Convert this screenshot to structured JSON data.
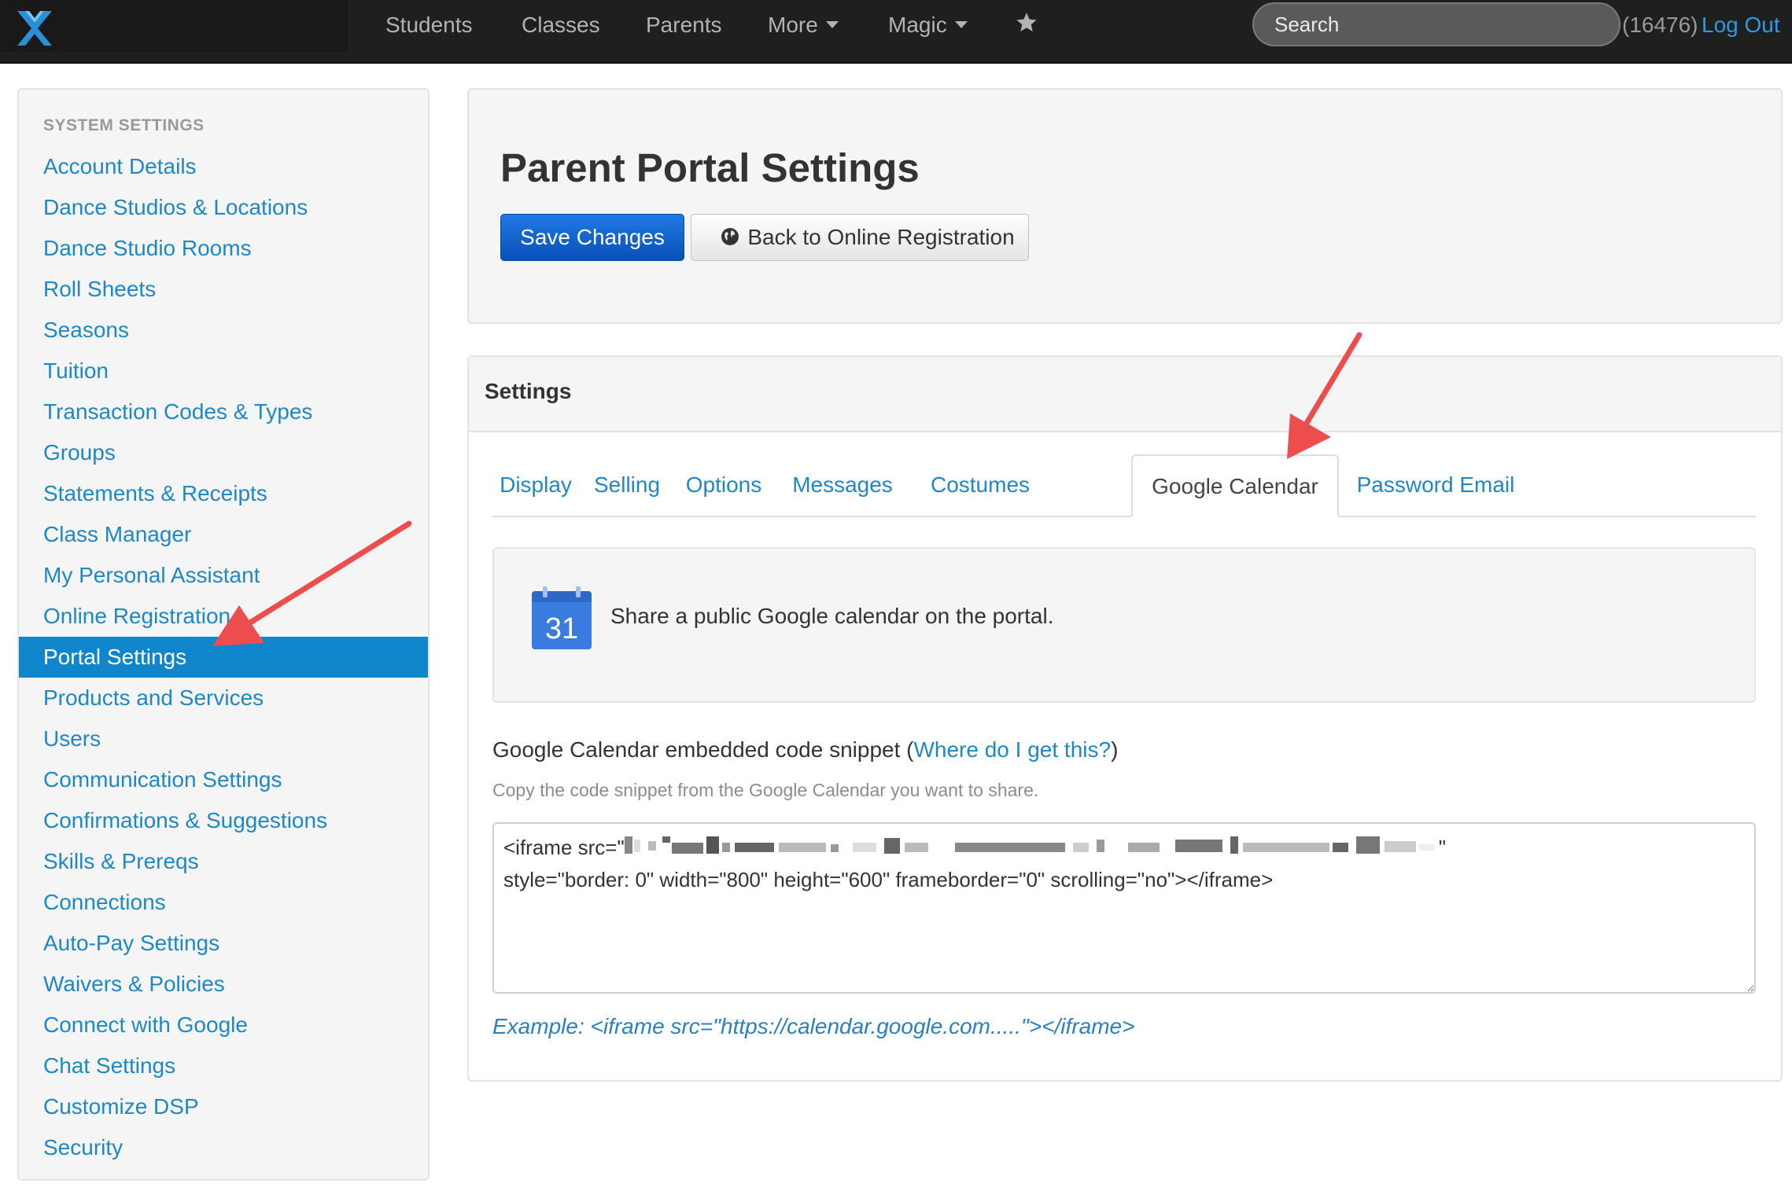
{
  "navbar": {
    "items": [
      "Students",
      "Classes",
      "Parents",
      "More",
      "Magic"
    ],
    "search_placeholder": "Search",
    "user_count": "(16476)",
    "logout": "Log Out"
  },
  "sidebar": {
    "header": "SYSTEM SETTINGS",
    "items": [
      "Account Details",
      "Dance Studios & Locations",
      "Dance Studio Rooms",
      "Roll Sheets",
      "Seasons",
      "Tuition",
      "Transaction Codes & Types",
      "Groups",
      "Statements & Receipts",
      "Class Manager",
      "My Personal Assistant",
      "Online Registration",
      "Portal Settings",
      "Products and Services",
      "Users",
      "Communication Settings",
      "Confirmations & Suggestions",
      "Skills & Prereqs",
      "Connections",
      "Auto-Pay Settings",
      "Waivers & Policies",
      "Connect with Google",
      "Chat Settings",
      "Customize DSP",
      "Security"
    ],
    "active": "Portal Settings"
  },
  "header": {
    "title": "Parent Portal Settings",
    "save_label": "Save Changes",
    "back_label": "Back to Online Registration"
  },
  "settings": {
    "title": "Settings",
    "tabs": [
      "Display",
      "Selling",
      "Options",
      "Messages",
      "Costumes",
      "Google Calendar",
      "Password Email"
    ],
    "active_tab": "Google Calendar",
    "info": {
      "calendar_day": "31",
      "text": "Share a public Google calendar on the portal."
    },
    "snippet_label_prefix": "Google Calendar embedded code snippet (",
    "snippet_link": "Where do I get this?",
    "snippet_label_suffix": ")",
    "help": "Copy the code snippet from the Google Calendar you want to share.",
    "code_line1_start": "<iframe src=\"",
    "code_line1_end": "\"",
    "code_line2": "style=\"border: 0\" width=\"800\" height=\"600\" frameborder=\"0\" scrolling=\"no\"></iframe>",
    "example": "Example: <iframe src=\"https://calendar.google.com.....\"></iframe>"
  },
  "colors": {
    "navbar_bg": "#1f1f1f",
    "link": "#1e88c7",
    "active_bg": "#0f86cc",
    "primary_button": "#1360d0",
    "annotation_arrow": "#ee4d4d"
  }
}
